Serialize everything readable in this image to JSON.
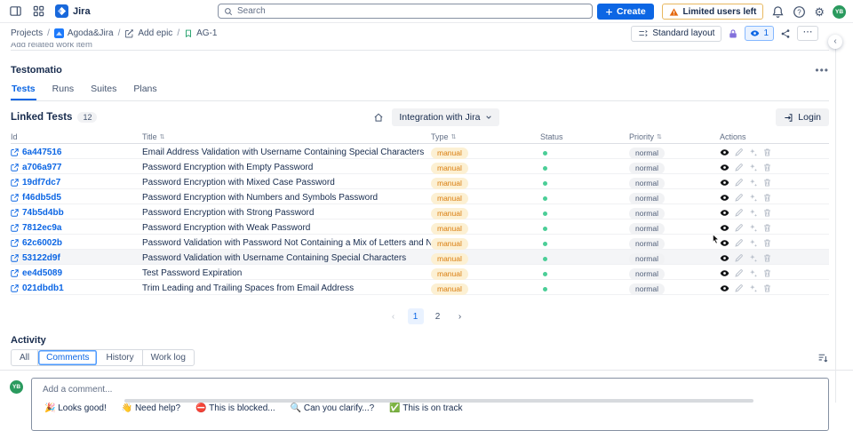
{
  "colors": {
    "brand_blue": "#0c66e4",
    "warning_orange": "#e56910",
    "lock_purple": "#8270db",
    "status_green": "#4bce97",
    "manual_badge_bg": "#fcf0d3",
    "manual_badge_text": "#d97d0e",
    "avatar_green": "#2a9a5e"
  },
  "top_nav": {
    "app_name": "Jira",
    "search_placeholder": "Search",
    "create_label": "Create",
    "warning_label": "Limited users left",
    "avatar_initials": "YB"
  },
  "breadcrumbs": {
    "projects": "Projects",
    "project_name": "Agoda&Jira",
    "add_epic": "Add epic",
    "issue_key": "AG-1"
  },
  "toolbar": {
    "standard_layout_label": "Standard layout",
    "watch_count": "1"
  },
  "scroll_text": "Add related work item",
  "testomatio": {
    "title": "Testomatio",
    "tabs": [
      "Tests",
      "Runs",
      "Suites",
      "Plans"
    ],
    "active_tab": "Tests",
    "linked_tests_label": "Linked Tests",
    "linked_tests_count": "12",
    "integration_dropdown_label": "Integration with Jira",
    "login_label": "Login"
  },
  "table": {
    "headers": {
      "id": "Id",
      "title": "Title",
      "type": "Type",
      "status": "Status",
      "priority": "Priority",
      "actions": "Actions"
    },
    "highlighted_row_id": "53122d9f",
    "rows": [
      {
        "id": "6a447516",
        "title": "Email Address Validation with Username Containing Special Characters",
        "type": "manual",
        "priority": "normal"
      },
      {
        "id": "a706a977",
        "title": "Password Encryption with Empty Password",
        "type": "manual",
        "priority": "normal"
      },
      {
        "id": "19df7dc7",
        "title": "Password Encryption with Mixed Case Password",
        "type": "manual",
        "priority": "normal"
      },
      {
        "id": "f46db5d5",
        "title": "Password Encryption with Numbers and Symbols Password",
        "type": "manual",
        "priority": "normal"
      },
      {
        "id": "74b5d4bb",
        "title": "Password Encryption with Strong Password",
        "type": "manual",
        "priority": "normal"
      },
      {
        "id": "7812ec9a",
        "title": "Password Encryption with Weak Password",
        "type": "manual",
        "priority": "normal"
      },
      {
        "id": "62c6002b",
        "title": "Password Validation with Password Not Containing a Mix of Letters and Numbers",
        "type": "manual",
        "priority": "normal"
      },
      {
        "id": "53122d9f",
        "title": "Password Validation with Username Containing Special Characters",
        "type": "manual",
        "priority": "normal"
      },
      {
        "id": "ee4d5089",
        "title": "Test Password Expiration",
        "type": "manual",
        "priority": "normal"
      },
      {
        "id": "021dbdb1",
        "title": "Trim Leading and Trailing Spaces from Email Address",
        "type": "manual",
        "priority": "normal"
      }
    ]
  },
  "pagination": {
    "pages": [
      "1",
      "2"
    ],
    "current_page": "1"
  },
  "activity": {
    "title": "Activity",
    "tabs": [
      "All",
      "Comments",
      "History",
      "Work log"
    ],
    "active_tab": "Comments"
  },
  "comment_box": {
    "placeholder": "Add a comment...",
    "quick_replies": [
      "🎉 Looks good!",
      "👋 Need help?",
      "⛔ This is blocked...",
      "🔍 Can you clarify...?",
      "✅ This is on track"
    ]
  }
}
